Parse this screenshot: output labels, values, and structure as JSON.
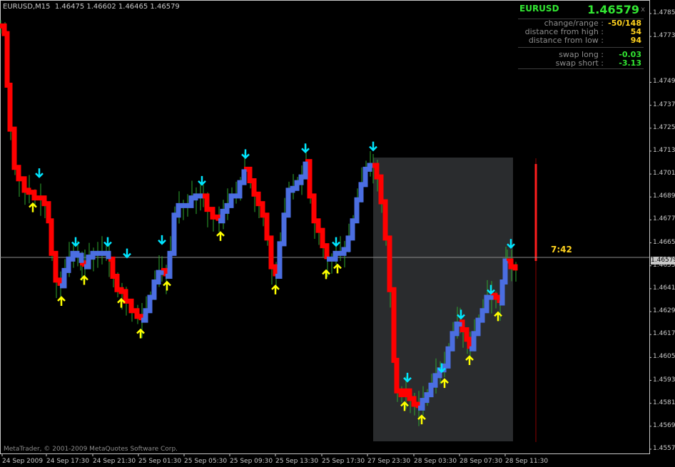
{
  "window": {
    "header": "EURUSD,M15  1.46475 1.46602 1.46465 1.46579",
    "copyright": "MetaTrader, © 2001-2009 MetaQuotes Software Corp.",
    "bar_timer": "7:42",
    "current_price_tag": "1.46579"
  },
  "info_panel": {
    "symbol": "EURUSD",
    "price": "1.46579",
    "close": "x",
    "rows": [
      {
        "label": "change/range :",
        "value": "-50/148"
      },
      {
        "label": "distance from high :",
        "value": "54"
      },
      {
        "label": "distance from low :",
        "value": "94"
      },
      {
        "label": "swap long :",
        "value": "-0.03"
      },
      {
        "label": "swap short :",
        "value": "-3.13"
      }
    ],
    "colors": {
      "up": "#32e632",
      "warn": "#ffd21e",
      "label": "#8c8c8c"
    }
  },
  "chart_data": {
    "type": "line",
    "title": "EURUSD,M15",
    "y_ticks": [
      "1.47855",
      "1.47735",
      "1.47495",
      "1.47375",
      "1.47255",
      "1.47135",
      "1.47015",
      "1.46895",
      "1.46775",
      "1.46655",
      "1.46535",
      "1.46415",
      "1.46295",
      "1.46175",
      "1.46055",
      "1.45935",
      "1.45815",
      "1.45695",
      "1.45575"
    ],
    "x_ticks": [
      "24 Sep 2009",
      "24 Sep 17:30",
      "24 Sep 21:30",
      "25 Sep 01:30",
      "25 Sep 05:30",
      "25 Sep 09:30",
      "25 Sep 13:30",
      "25 Sep 17:30",
      "27 Sep 23:30",
      "28 Sep 03:30",
      "28 Sep 07:30",
      "28 Sep 11:30"
    ],
    "ylim": [
      1.4557,
      1.4791
    ],
    "current_price": 1.46579,
    "series": [
      {
        "color_key": "red",
        "segments": [
          [
            [
              0,
              1.4779
            ],
            [
              6,
              1.4775
            ],
            [
              10,
              1.4748
            ],
            [
              14,
              1.4725
            ],
            [
              20,
              1.4705
            ],
            [
              26,
              1.4699
            ],
            [
              34,
              1.4693
            ],
            [
              40,
              1.4692
            ],
            [
              48,
              1.4689
            ],
            [
              56,
              1.4689
            ],
            [
              62,
              1.4686
            ],
            [
              68,
              1.4677
            ],
            [
              72,
              1.466
            ],
            [
              78,
              1.4646
            ],
            [
              84,
              1.4643
            ]
          ],
          [
            [
              112,
              1.4655
            ],
            [
              118,
              1.4653
            ]
          ],
          [
            [
              152,
              1.4657
            ],
            [
              158,
              1.4648
            ],
            [
              164,
              1.4641
            ],
            [
              170,
              1.464
            ],
            [
              176,
              1.4635
            ],
            [
              184,
              1.463
            ],
            [
              192,
              1.4627
            ],
            [
              198,
              1.4625
            ]
          ],
          [
            [
              226,
              1.4651
            ],
            [
              232,
              1.4648
            ]
          ],
          [
            [
              284,
              1.469
            ],
            [
              290,
              1.4683
            ],
            [
              298,
              1.4679
            ],
            [
              306,
              1.4677
            ]
          ],
          [
            [
              342,
              1.4704
            ],
            [
              350,
              1.4698
            ],
            [
              356,
              1.4691
            ],
            [
              362,
              1.4686
            ],
            [
              368,
              1.468
            ],
            [
              374,
              1.4668
            ],
            [
              380,
              1.4653
            ],
            [
              386,
              1.4648
            ]
          ],
          [
            [
              428,
              1.4708
            ],
            [
              434,
              1.469
            ],
            [
              440,
              1.4677
            ],
            [
              446,
              1.4672
            ],
            [
              452,
              1.4664
            ],
            [
              458,
              1.4657
            ]
          ],
          [
            [
              522,
              1.4706
            ],
            [
              528,
              1.47
            ],
            [
              534,
              1.4687
            ],
            [
              540,
              1.4668
            ],
            [
              546,
              1.4641
            ],
            [
              552,
              1.4604
            ],
            [
              556,
              1.4588
            ],
            [
              562,
              1.4586
            ],
            [
              568,
              1.4588
            ],
            [
              574,
              1.4584
            ],
            [
              580,
              1.4581
            ],
            [
              586,
              1.4579
            ]
          ],
          [
            [
              644,
              1.4624
            ],
            [
              648,
              1.462
            ],
            [
              654,
              1.4615
            ],
            [
              658,
              1.461
            ]
          ],
          [
            [
              688,
              1.4638
            ],
            [
              694,
              1.4637
            ],
            [
              700,
              1.4634
            ]
          ],
          [
            [
              710,
              1.4656
            ],
            [
              716,
              1.4653
            ],
            [
              722,
              1.4651
            ]
          ]
        ]
      },
      {
        "color_key": "blue",
        "segments": [
          [
            [
              84,
              1.4643
            ],
            [
              90,
              1.4651
            ],
            [
              96,
              1.4657
            ],
            [
              102,
              1.466
            ],
            [
              108,
              1.4659
            ],
            [
              114,
              1.4655
            ]
          ],
          [
            [
              118,
              1.4653
            ],
            [
              124,
              1.4658
            ],
            [
              130,
              1.466
            ],
            [
              136,
              1.466
            ],
            [
              142,
              1.466
            ],
            [
              148,
              1.466
            ],
            [
              152,
              1.4657
            ]
          ],
          [
            [
              198,
              1.4625
            ],
            [
              204,
              1.463
            ],
            [
              210,
              1.4637
            ],
            [
              216,
              1.4645
            ],
            [
              222,
              1.465
            ],
            [
              226,
              1.4651
            ]
          ],
          [
            [
              232,
              1.4648
            ],
            [
              238,
              1.466
            ],
            [
              244,
              1.468
            ],
            [
              250,
              1.4685
            ],
            [
              256,
              1.4685
            ],
            [
              262,
              1.4685
            ],
            [
              268,
              1.4689
            ],
            [
              274,
              1.469
            ],
            [
              280,
              1.469
            ],
            [
              284,
              1.469
            ]
          ],
          [
            [
              306,
              1.4677
            ],
            [
              312,
              1.4682
            ],
            [
              318,
              1.4685
            ],
            [
              324,
              1.469
            ],
            [
              330,
              1.469
            ],
            [
              336,
              1.4697
            ],
            [
              342,
              1.4704
            ]
          ],
          [
            [
              386,
              1.4648
            ],
            [
              392,
              1.4665
            ],
            [
              398,
              1.468
            ],
            [
              404,
              1.4693
            ],
            [
              410,
              1.4694
            ],
            [
              416,
              1.4697
            ],
            [
              422,
              1.47
            ],
            [
              428,
              1.4708
            ]
          ],
          [
            [
              458,
              1.4657
            ],
            [
              464,
              1.4657
            ],
            [
              470,
              1.466
            ],
            [
              476,
              1.466
            ],
            [
              482,
              1.4662
            ],
            [
              488,
              1.4668
            ],
            [
              494,
              1.4677
            ],
            [
              500,
              1.4688
            ],
            [
              506,
              1.4696
            ],
            [
              512,
              1.4704
            ],
            [
              518,
              1.4706
            ],
            [
              522,
              1.4706
            ]
          ],
          [
            [
              586,
              1.4579
            ],
            [
              592,
              1.4583
            ],
            [
              598,
              1.4586
            ],
            [
              604,
              1.4591
            ],
            [
              610,
              1.4596
            ],
            [
              616,
              1.4599
            ],
            [
              622,
              1.4601
            ],
            [
              628,
              1.461
            ],
            [
              634,
              1.4618
            ],
            [
              640,
              1.4623
            ],
            [
              644,
              1.4624
            ]
          ],
          [
            [
              658,
              1.461
            ],
            [
              664,
              1.4618
            ],
            [
              670,
              1.4625
            ],
            [
              676,
              1.463
            ],
            [
              682,
              1.4637
            ],
            [
              688,
              1.4638
            ]
          ],
          [
            [
              700,
              1.4634
            ],
            [
              704,
              1.4645
            ],
            [
              708,
              1.4656
            ],
            [
              710,
              1.4656
            ]
          ]
        ]
      }
    ],
    "arrows_down": [
      [
        55,
        1.47
      ],
      [
        106,
        1.4664
      ],
      [
        151,
        1.4664
      ],
      [
        178,
        1.4658
      ],
      [
        227,
        1.4665
      ],
      [
        283,
        1.4696
      ],
      [
        344,
        1.471
      ],
      [
        428,
        1.4713
      ],
      [
        471,
        1.4664
      ],
      [
        523,
        1.4714
      ],
      [
        571,
        1.4593
      ],
      [
        619,
        1.4598
      ],
      [
        646,
        1.4626
      ],
      [
        688,
        1.4639
      ],
      [
        716,
        1.4663
      ]
    ],
    "arrows_up": [
      [
        46,
        1.4686
      ],
      [
        86,
        1.4637
      ],
      [
        118,
        1.4648
      ],
      [
        170,
        1.4636
      ],
      [
        197,
        1.462
      ],
      [
        234,
        1.4645
      ],
      [
        309,
        1.4671
      ],
      [
        386,
        1.4643
      ],
      [
        457,
        1.4651
      ],
      [
        473,
        1.4654
      ],
      [
        567,
        1.4582
      ],
      [
        591,
        1.4575
      ],
      [
        623,
        1.4594
      ],
      [
        658,
        1.4606
      ],
      [
        698,
        1.4629
      ]
    ]
  }
}
